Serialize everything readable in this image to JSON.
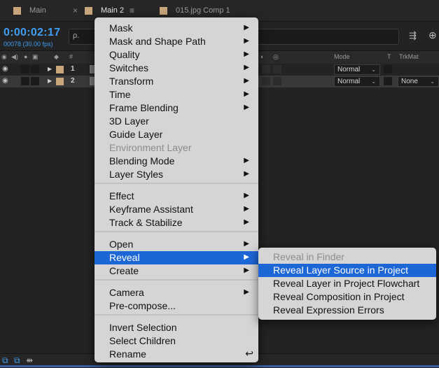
{
  "tabs": [
    {
      "label": "Main",
      "color": "#c8a57a"
    },
    {
      "label": "Main 2",
      "color": "#c8a57a",
      "close": "×",
      "menu": "≡"
    },
    {
      "label": "015.jpg Comp 1",
      "color": "#c8a57a"
    }
  ],
  "timecode": {
    "value": "0:00:02:17",
    "sub": "00078 (30.00 fps)"
  },
  "search": {
    "icon": "ρ.",
    "value": ""
  },
  "header": {
    "mode": "Mode",
    "t": "T",
    "trkmat": "TrkMat",
    "hash": "#"
  },
  "layers": [
    {
      "num": "1",
      "mode": "Normal",
      "trkmat": "",
      "color": "#c8a57a"
    },
    {
      "num": "2",
      "mode": "Normal",
      "trkmat": "None",
      "color": "#c8a57a"
    }
  ],
  "menu": {
    "items": [
      {
        "label": "Mask",
        "sub": true
      },
      {
        "label": "Mask and Shape Path",
        "sub": true
      },
      {
        "label": "Quality",
        "sub": true
      },
      {
        "label": "Switches",
        "sub": true
      },
      {
        "label": "Transform",
        "sub": true
      },
      {
        "label": "Time",
        "sub": true
      },
      {
        "label": "Frame Blending",
        "sub": true
      },
      {
        "label": "3D Layer"
      },
      {
        "label": "Guide Layer"
      },
      {
        "label": "Environment Layer",
        "disabled": true
      },
      {
        "label": "Blending Mode",
        "sub": true
      },
      {
        "label": "Layer Styles",
        "sub": true
      },
      {
        "label": "Effect",
        "sub": true
      },
      {
        "label": "Keyframe Assistant",
        "sub": true
      },
      {
        "label": "Track & Stabilize",
        "sub": true
      },
      {
        "label": "Open",
        "sub": true
      },
      {
        "label": "Reveal",
        "sub": true,
        "highlighted": true
      },
      {
        "label": "Create",
        "sub": true
      },
      {
        "label": "Camera",
        "sub": true
      },
      {
        "label": "Pre-compose..."
      },
      {
        "label": "Invert Selection"
      },
      {
        "label": "Select Children"
      },
      {
        "label": "Rename",
        "shortcut": "↩"
      }
    ]
  },
  "submenu": {
    "items": [
      {
        "label": "Reveal in Finder",
        "disabled": true
      },
      {
        "label": "Reveal Layer Source in Project",
        "highlighted": true
      },
      {
        "label": "Reveal Layer in Project Flowchart"
      },
      {
        "label": "Reveal Composition in Project"
      },
      {
        "label": "Reveal Expression Errors"
      }
    ]
  },
  "colors": {
    "accent": "#3f9ef4",
    "highlight": "#1d66d6",
    "menu_bg": "#d5d5d5"
  }
}
